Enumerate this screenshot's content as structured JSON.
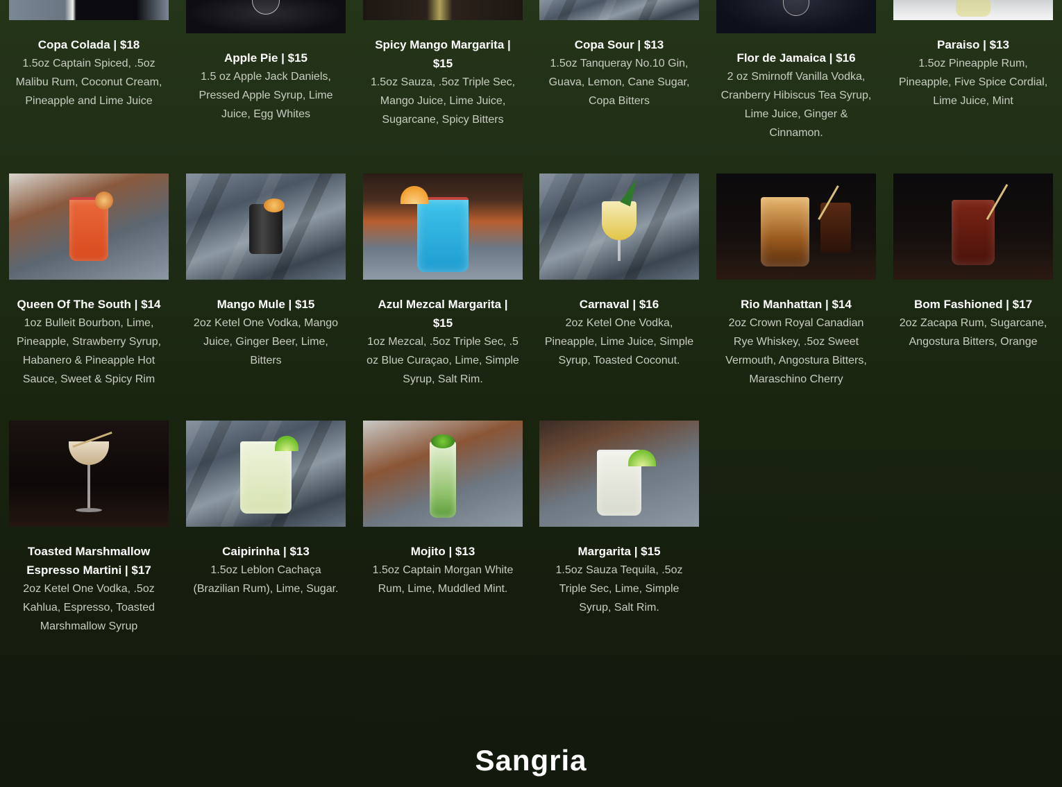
{
  "drinks": [
    {
      "name": "Copa Colada | $18",
      "desc": "1.5oz Captain Spiced, .5oz Malibu Rum, Coconut Cream, Pineapple and Lime Juice"
    },
    {
      "name": "Apple Pie | $15",
      "desc": "1.5 oz Apple Jack Daniels, Pressed Apple Syrup, Lime Juice, Egg Whites"
    },
    {
      "name": "Spicy Mango Margarita | $15",
      "desc": "1.5oz Sauza, .5oz Triple Sec, Mango Juice, Lime Juice, Sugarcane, Spicy Bitters"
    },
    {
      "name": "Copa Sour | $13",
      "desc": "1.5oz Tanqueray No.10 Gin, Guava, Lemon, Cane Sugar, Copa Bitters"
    },
    {
      "name": "Flor de Jamaica | $16",
      "desc": "2 oz Smirnoff Vanilla Vodka, Cranberry Hibiscus Tea Syrup, Lime Juice, Ginger & Cinnamon."
    },
    {
      "name": "Paraiso | $13",
      "desc": "1.5oz Pineapple Rum, Pineapple, Five Spice Cordial, Lime Juice, Mint"
    },
    {
      "name": "Queen Of The South | $14",
      "desc": "1oz Bulleit Bourbon, Lime, Pineapple, Strawberry Syrup, Habanero & Pineapple Hot Sauce, Sweet & Spicy Rim"
    },
    {
      "name": "Mango Mule | $15",
      "desc": "2oz Ketel One Vodka, Mango Juice, Ginger Beer, Lime, Bitters"
    },
    {
      "name": "Azul Mezcal Margarita | $15",
      "desc": "1oz Mezcal, .5oz Triple Sec, .5 oz Blue Curaçao, Lime, Simple Syrup, Salt Rim."
    },
    {
      "name": "Carnaval | $16",
      "desc": "2oz Ketel One Vodka, Pineapple, Lime Juice, Simple Syrup, Toasted Coconut."
    },
    {
      "name": "Rio Manhattan | $14",
      "desc": "2oz Crown Royal Canadian Rye Whiskey, .5oz Sweet Vermouth, Angostura Bitters, Maraschino Cherry"
    },
    {
      "name": "Bom Fashioned | $17",
      "desc": "2oz Zacapa Rum, Sugarcane, Angostura Bitters, Orange"
    },
    {
      "name": "Toasted Marshmallow Espresso Martini | $17",
      "desc": "2oz Ketel One Vodka, .5oz Kahlua, Espresso, Toasted Marshmallow Syrup"
    },
    {
      "name": "Caipirinha | $13",
      "desc": "1.5oz Leblon Cachaça (Brazilian Rum), Lime, Sugar."
    },
    {
      "name": "Mojito | $13",
      "desc": "1.5oz Captain Morgan White Rum, Lime, Muddled Mint."
    },
    {
      "name": "Margarita | $15",
      "desc": "1.5oz Sauza Tequila, .5oz Triple Sec, Lime, Simple Syrup, Salt Rim."
    }
  ],
  "next_section": {
    "title": "Sangria"
  },
  "colors": {
    "background_top": "#253519",
    "background_bottom": "#12190d",
    "title_text": "#ffffff",
    "desc_text": "#c9cdc1"
  }
}
